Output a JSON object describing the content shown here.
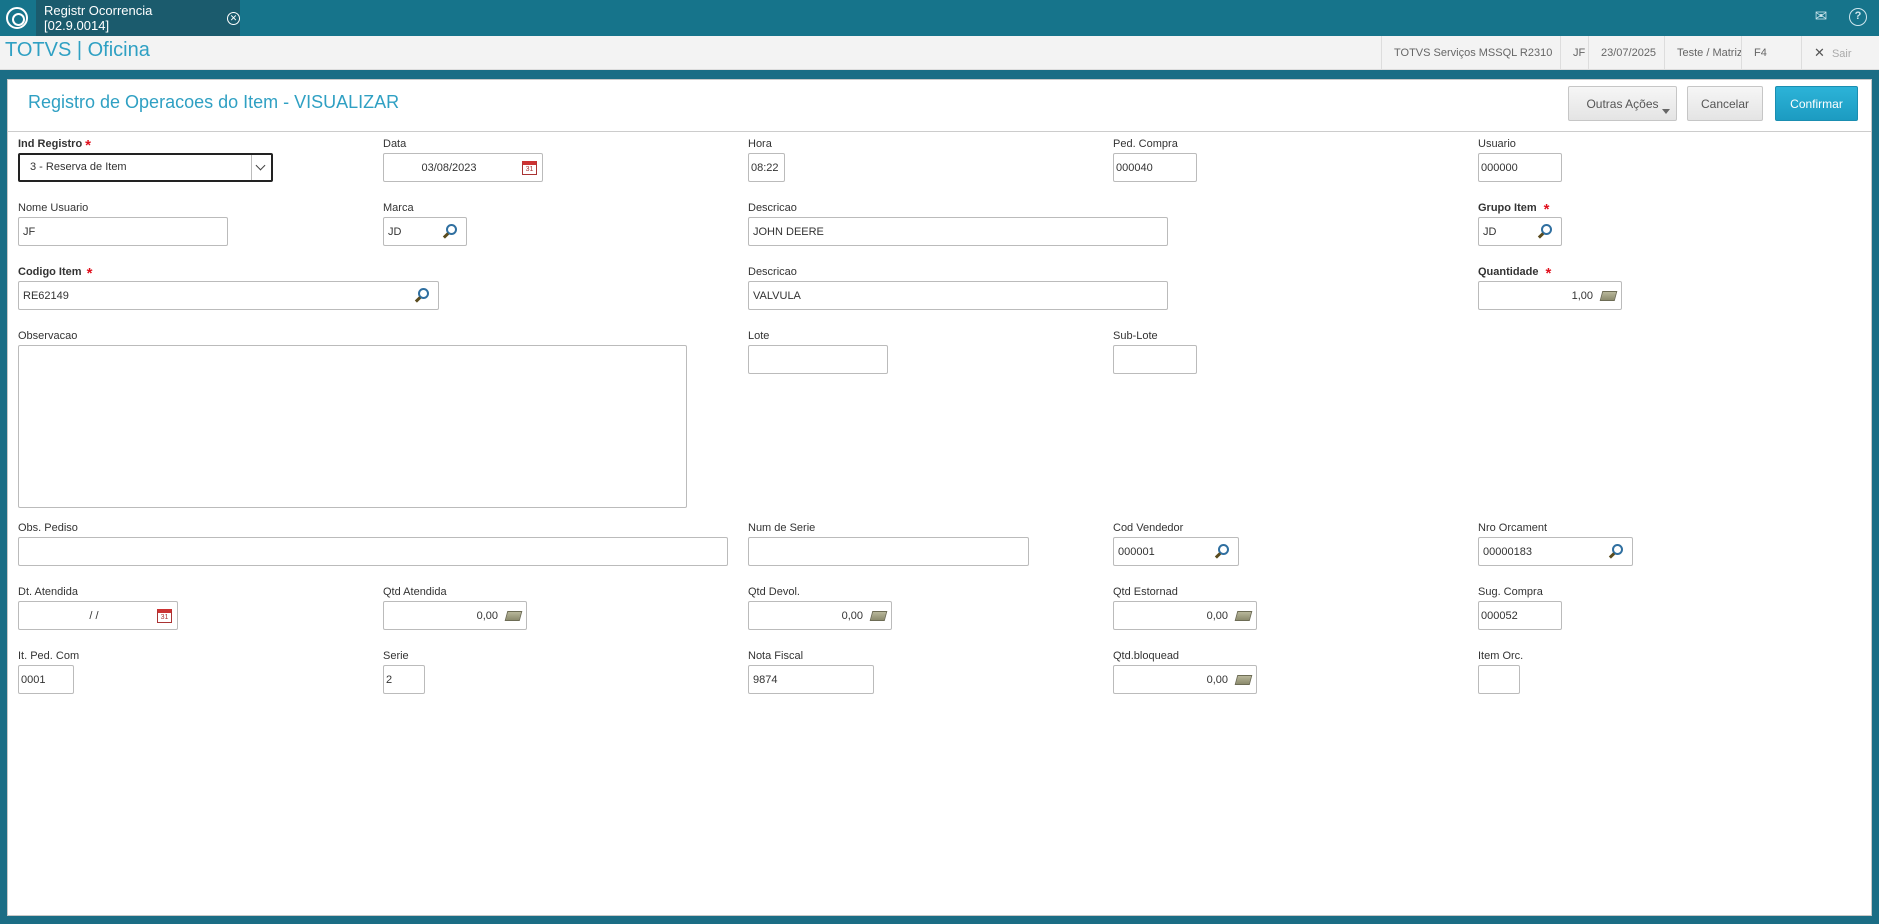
{
  "topbar": {
    "tab_label": "Registr Ocorrencia [02.9.0014]",
    "mail_icon": "mail-icon",
    "help_icon": "help-icon",
    "help_glyph": "?"
  },
  "infobar": {
    "app_title": "TOTVS | Oficina",
    "environment": "TOTVS Serviços MSSQL R2310",
    "user": "JF",
    "date": "23/07/2025",
    "company": "Teste / Matriz",
    "shortcut": "F4",
    "exit": "Sair"
  },
  "page": {
    "title": "Registro de Operacoes do Item - VISUALIZAR",
    "buttons": {
      "other_actions": "Outras Ações",
      "cancel": "Cancelar",
      "confirm": "Confirmar"
    }
  },
  "form": {
    "ind_registro": {
      "label": "Ind Registro",
      "value": "3 - Reserva de Item"
    },
    "data": {
      "label": "Data",
      "value": "03/08/2023"
    },
    "hora": {
      "label": "Hora",
      "value": "08:22"
    },
    "ped_compra": {
      "label": "Ped. Compra",
      "value": "000040"
    },
    "usuario": {
      "label": "Usuario",
      "value": "000000"
    },
    "nome_usuario": {
      "label": "Nome Usuario",
      "value": "JF"
    },
    "marca": {
      "label": "Marca",
      "value": "JD"
    },
    "descricao_marca": {
      "label": "Descricao",
      "value": "JOHN DEERE"
    },
    "grupo_item": {
      "label": "Grupo Item",
      "value": "JD"
    },
    "codigo_item": {
      "label": "Codigo Item",
      "value": "RE62149"
    },
    "descricao_item": {
      "label": "Descricao",
      "value": "VALVULA"
    },
    "quantidade": {
      "label": "Quantidade",
      "value": "1,00"
    },
    "observacao": {
      "label": "Observacao",
      "value": ""
    },
    "lote": {
      "label": "Lote",
      "value": ""
    },
    "sub_lote": {
      "label": "Sub-Lote",
      "value": ""
    },
    "obs_pediso": {
      "label": "Obs. Pediso",
      "value": ""
    },
    "num_serie": {
      "label": "Num de Serie",
      "value": ""
    },
    "cod_vendedor": {
      "label": "Cod Vendedor",
      "value": "000001"
    },
    "nro_orcament": {
      "label": "Nro Orcament",
      "value": "00000183"
    },
    "dt_atendida": {
      "label": "Dt. Atendida",
      "value": "/ /"
    },
    "qtd_atendida": {
      "label": "Qtd Atendida",
      "value": "0,00"
    },
    "qtd_devol": {
      "label": "Qtd Devol.",
      "value": "0,00"
    },
    "qtd_estornad": {
      "label": "Qtd Estornad",
      "value": "0,00"
    },
    "sug_compra": {
      "label": "Sug. Compra",
      "value": "000052"
    },
    "it_ped_com": {
      "label": "It. Ped. Com",
      "value": "0001"
    },
    "serie": {
      "label": "Serie",
      "value": "2"
    },
    "nota_fiscal": {
      "label": "Nota Fiscal",
      "value": "9874"
    },
    "qtd_bloquead": {
      "label": "Qtd.bloquead",
      "value": "0,00"
    },
    "item_orc": {
      "label": "Item Orc.",
      "value": ""
    }
  },
  "colors": {
    "topbar": "#16748b",
    "accent": "#2fa0c3",
    "confirm": "#1c9bc1",
    "required": "#e0101d"
  }
}
